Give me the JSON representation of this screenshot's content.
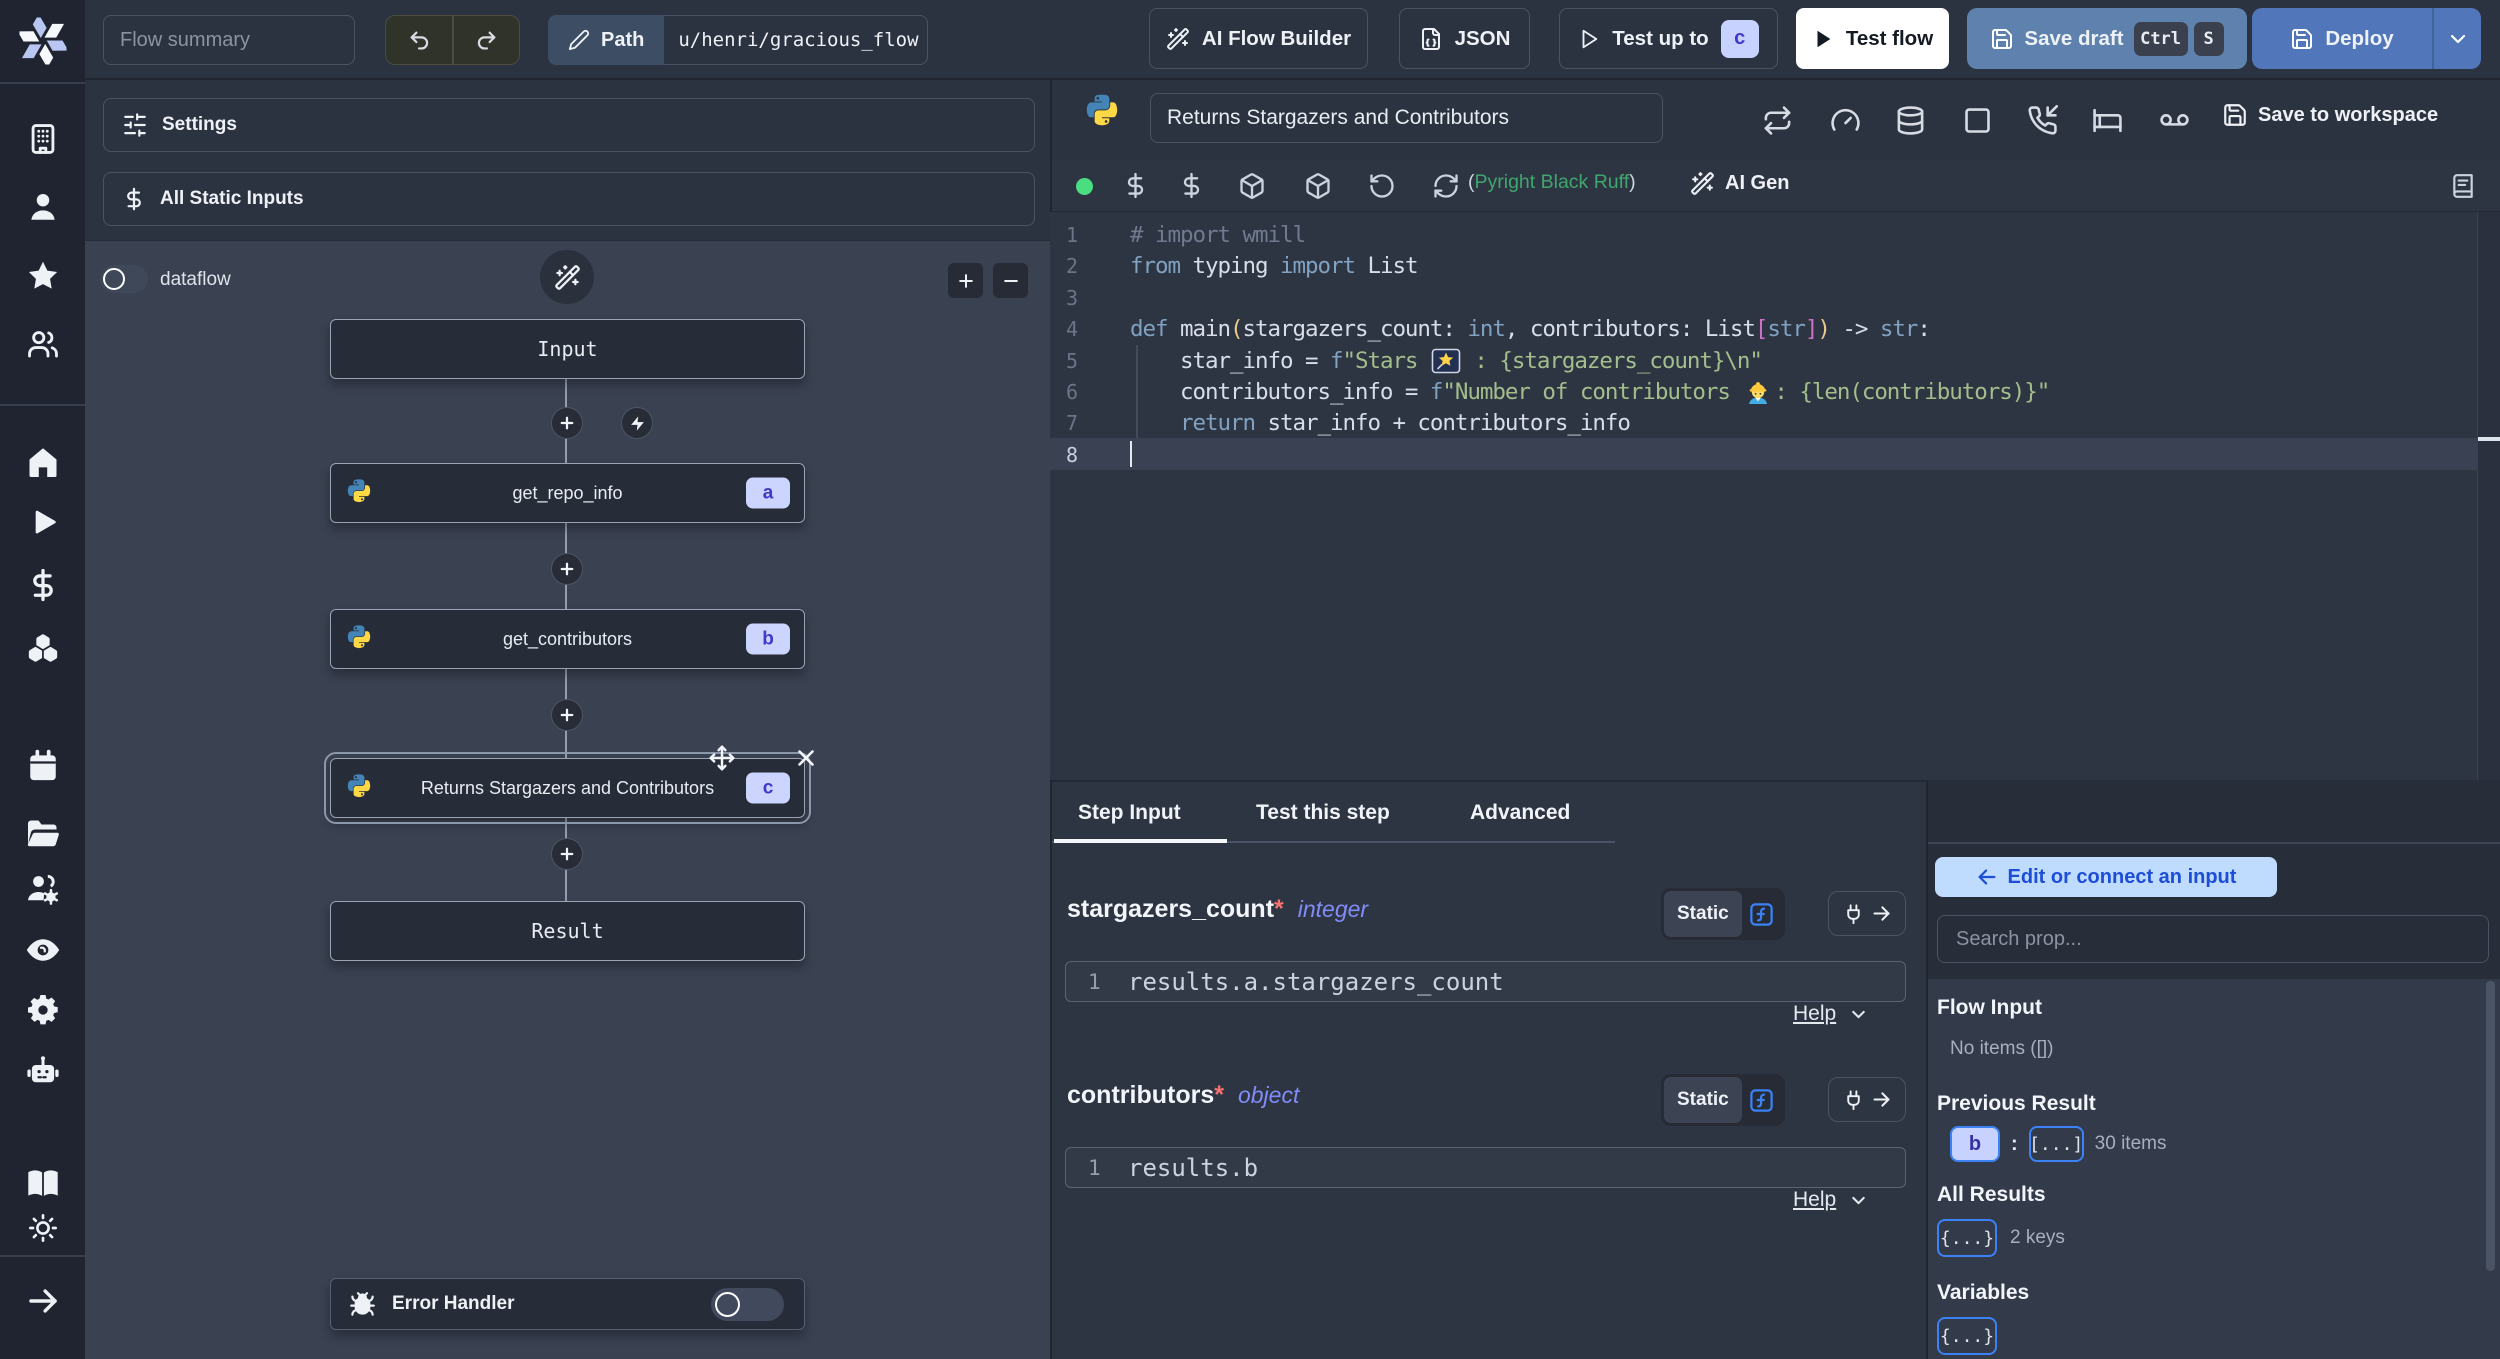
{
  "topbar": {
    "flow_summary_placeholder": "Flow summary",
    "path_label": "Path",
    "path_value": "u/henri/gracious_flow",
    "ai_flow_builder_label": "AI Flow Builder",
    "json_label": "JSON",
    "test_up_to_label": "Test up to",
    "test_up_to_badge": "c",
    "test_flow_label": "Test flow",
    "save_draft_label": "Save draft",
    "kbd_ctrl": "Ctrl",
    "kbd_s": "S",
    "deploy_label": "Deploy"
  },
  "left_panel": {
    "settings_label": "Settings",
    "all_static_inputs_label": "All Static Inputs",
    "dataflow_label": "dataflow",
    "zoom_in": "+",
    "zoom_out": "−",
    "nodes": {
      "input": "Input",
      "step_a": {
        "label": "get_repo_info",
        "badge": "a"
      },
      "step_b": {
        "label": "get_contributors",
        "badge": "b"
      },
      "step_c": {
        "label": "Returns Stargazers and Contributors",
        "badge": "c"
      },
      "result": "Result",
      "error_handler": "Error Handler"
    }
  },
  "script_header": {
    "title_value": "Returns Stargazers and Contributors",
    "save_to_workspace_label": "Save to workspace"
  },
  "editor_toolbar": {
    "assistants_open_paren": "(",
    "assistants_label": "Pyright Black Ruff",
    "assistants_close_paren": ")",
    "ai_gen_label": "AI Gen"
  },
  "code": {
    "language": "python",
    "lines": [
      "# import wmill",
      "from typing import List",
      "",
      "def main(stargazers_count: int, contributors: List[str]) -> str:",
      "    star_info = f\"Stars 🌠 : {stargazers_count}\\n\"",
      "    contributors_info = f\"Number of contributors 👷: {len(contributors)}\"",
      "    return star_info + contributors_info",
      ""
    ],
    "tokens": [
      [
        {
          "t": "# import wmill",
          "c": "cm"
        }
      ],
      [
        {
          "t": "from",
          "c": "kw"
        },
        {
          "t": " typing ",
          "c": "pl"
        },
        {
          "t": "import",
          "c": "kw"
        },
        {
          "t": " List",
          "c": "pl"
        }
      ],
      [],
      [
        {
          "t": "def",
          "c": "kw"
        },
        {
          "t": " main",
          "c": "pl"
        },
        {
          "t": "(",
          "c": "b1"
        },
        {
          "t": "stargazers_count: ",
          "c": "pl"
        },
        {
          "t": "int",
          "c": "kw"
        },
        {
          "t": ", contributors: List",
          "c": "pl"
        },
        {
          "t": "[",
          "c": "b2"
        },
        {
          "t": "str",
          "c": "kw"
        },
        {
          "t": "]",
          "c": "b2"
        },
        {
          "t": ")",
          "c": "b1"
        },
        {
          "t": " -> ",
          "c": "pl"
        },
        {
          "t": "str",
          "c": "kw"
        },
        {
          "t": ":",
          "c": "pl"
        }
      ],
      [
        {
          "t": "    star_info = ",
          "c": "pl"
        },
        {
          "t": "f",
          "c": "kw"
        },
        {
          "t": "\"Stars ",
          "c": "st"
        },
        {
          "e": "star"
        },
        {
          "t": " : {stargazers_count}\\n\"",
          "c": "st"
        }
      ],
      [
        {
          "t": "    contributors_info = ",
          "c": "pl"
        },
        {
          "t": "f",
          "c": "kw"
        },
        {
          "t": "\"Number of contributors ",
          "c": "st"
        },
        {
          "e": "worker"
        },
        {
          "t": ": {len(contributors)}\"",
          "c": "st"
        }
      ],
      [
        {
          "t": "    ",
          "c": "pl"
        },
        {
          "t": "return",
          "c": "kw"
        },
        {
          "t": " star_info + contributors_info",
          "c": "pl"
        }
      ],
      []
    ],
    "active_line": 8
  },
  "tabs": {
    "step_input": "Step Input",
    "test_this_step": "Test this step",
    "advanced": "Advanced"
  },
  "step_input": {
    "args": [
      {
        "name": "stargazers_count",
        "required_mark": "*",
        "type": "integer",
        "mode": "Static",
        "expr_line_no": "1",
        "expr": "results.a.stargazers_count",
        "help_label": "Help"
      },
      {
        "name": "contributors",
        "required_mark": "*",
        "type": "object",
        "mode": "Static",
        "expr_line_no": "1",
        "expr": "results.b",
        "help_label": "Help"
      }
    ]
  },
  "connect_panel": {
    "edit_button_label": "Edit or connect an input",
    "search_placeholder": "Search prop...",
    "flow_input_title": "Flow Input",
    "flow_input_empty": "No items ([])",
    "previous_result_title": "Previous Result",
    "previous_result_key": "b",
    "previous_result_colon": ":",
    "previous_result_badge": "[...]",
    "previous_result_count": "30 items",
    "all_results_title": "All Results",
    "all_results_badge": "{...}",
    "all_results_count": "2 keys",
    "variables_title": "Variables",
    "variables_badge": "{...}"
  },
  "colors": {
    "accent_lavender": "#c7d2fe",
    "accent_indigo": "#4338ca",
    "deploy_blue": "#5176ba",
    "save_draft_blue": "#5e81ae",
    "connect_button_bg": "#bfdbfe",
    "connect_button_text": "#1d4ed8",
    "assistants_green": "#3fa66d",
    "status_dot_green": "#4ade80"
  }
}
